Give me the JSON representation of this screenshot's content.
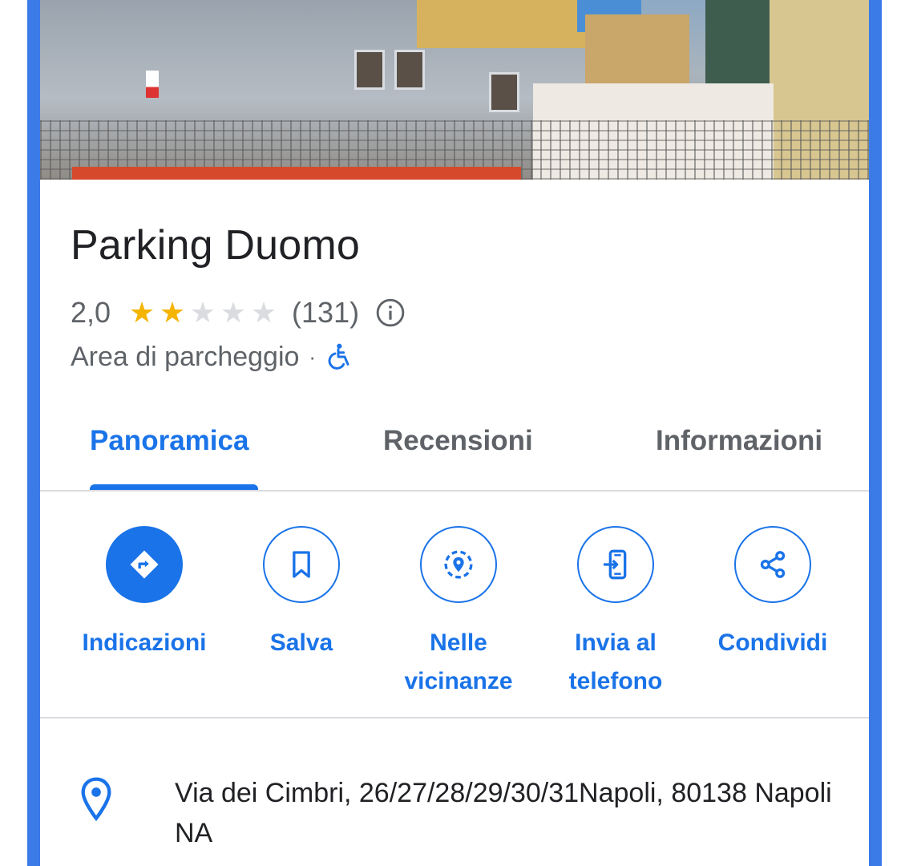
{
  "place": {
    "name": "Parking Duomo",
    "rating": "2,0",
    "rating_value": 2.0,
    "rating_max": 5,
    "review_count": "(131)",
    "category": "Area di parcheggio",
    "separator": "·"
  },
  "tabs": [
    {
      "label": "Panoramica",
      "active": true
    },
    {
      "label": "Recensioni",
      "active": false
    },
    {
      "label": "Informazioni",
      "active": false
    }
  ],
  "actions": [
    {
      "label": "Indicazioni",
      "icon": "directions-icon"
    },
    {
      "label": "Salva",
      "icon": "bookmark-icon"
    },
    {
      "label": "Nelle vicinanze",
      "icon": "nearby-icon"
    },
    {
      "label": "Invia al telefono",
      "icon": "send-to-phone-icon"
    },
    {
      "label": "Condividi",
      "icon": "share-icon"
    }
  ],
  "address": {
    "line": "Via dei Cimbri, 26/27/28/29/30/31Napoli, 80138 Napoli NA",
    "icon": "location-pin-icon"
  },
  "colors": {
    "accent": "#1a73e8",
    "star": "#f4b400",
    "frame": "#3b7be8"
  }
}
